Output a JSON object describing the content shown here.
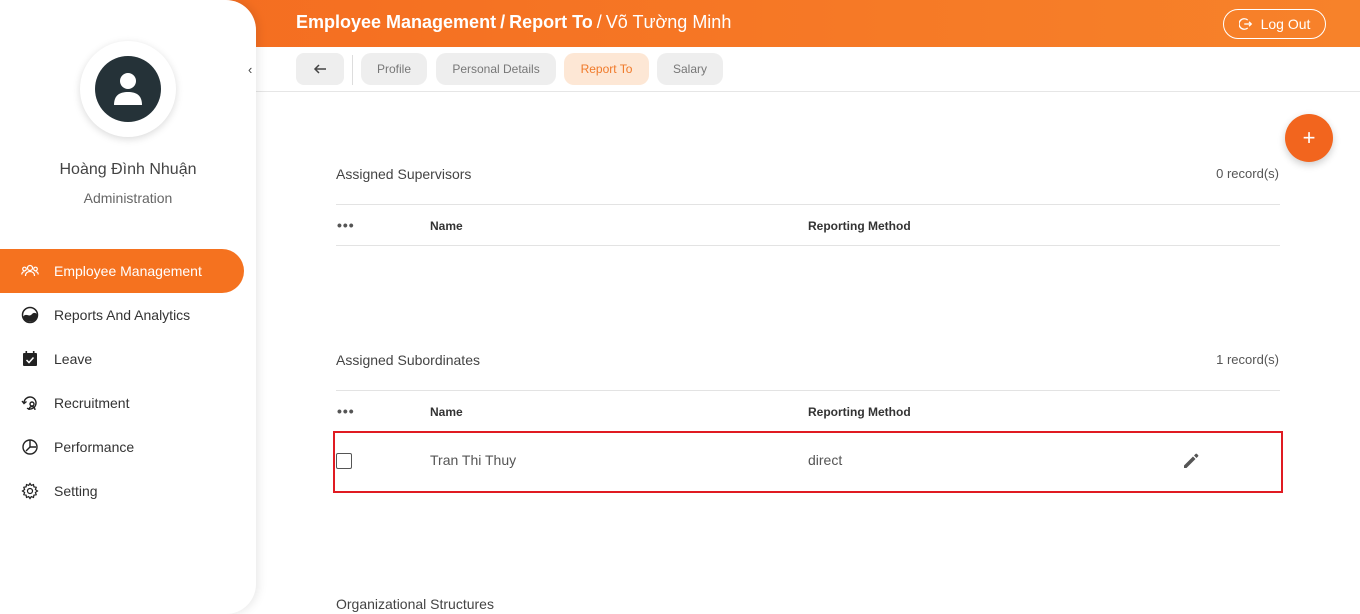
{
  "header": {
    "crumb_1": "Employee Management",
    "crumb_sep": "/",
    "crumb_2": "Report To",
    "crumb_3": "Võ Tường Minh",
    "logout_label": "Log Out"
  },
  "tabs": [
    {
      "label": "Profile"
    },
    {
      "label": "Personal Details"
    },
    {
      "label": "Report To"
    },
    {
      "label": "Salary"
    }
  ],
  "user": {
    "name": "Hoàng Đình Nhuận",
    "role": "Administration"
  },
  "nav": [
    {
      "label": "Employee Management",
      "icon": "users-icon"
    },
    {
      "label": "Reports And Analytics",
      "icon": "analytics-icon"
    },
    {
      "label": "Leave",
      "icon": "calendar-check-icon"
    },
    {
      "label": "Recruitment",
      "icon": "recruitment-icon"
    },
    {
      "label": "Performance",
      "icon": "performance-icon"
    },
    {
      "label": "Setting",
      "icon": "gear-icon"
    }
  ],
  "supervisors": {
    "title": "Assigned Supervisors",
    "count": "0 record(s)",
    "columns": {
      "more": "•••",
      "name": "Name",
      "method": "Reporting Method"
    }
  },
  "subordinates": {
    "title": "Assigned Subordinates",
    "count": "1 record(s)",
    "columns": {
      "more": "•••",
      "name": "Name",
      "method": "Reporting Method"
    },
    "rows": [
      {
        "name": "Tran Thi Thuy",
        "method": "direct"
      }
    ]
  },
  "org": {
    "title": "Organizational Structures"
  },
  "fab_label": "+",
  "colors": {
    "accent": "#f5721f",
    "highlight": "#e01b22",
    "active_tab_bg": "#fde7d5"
  }
}
